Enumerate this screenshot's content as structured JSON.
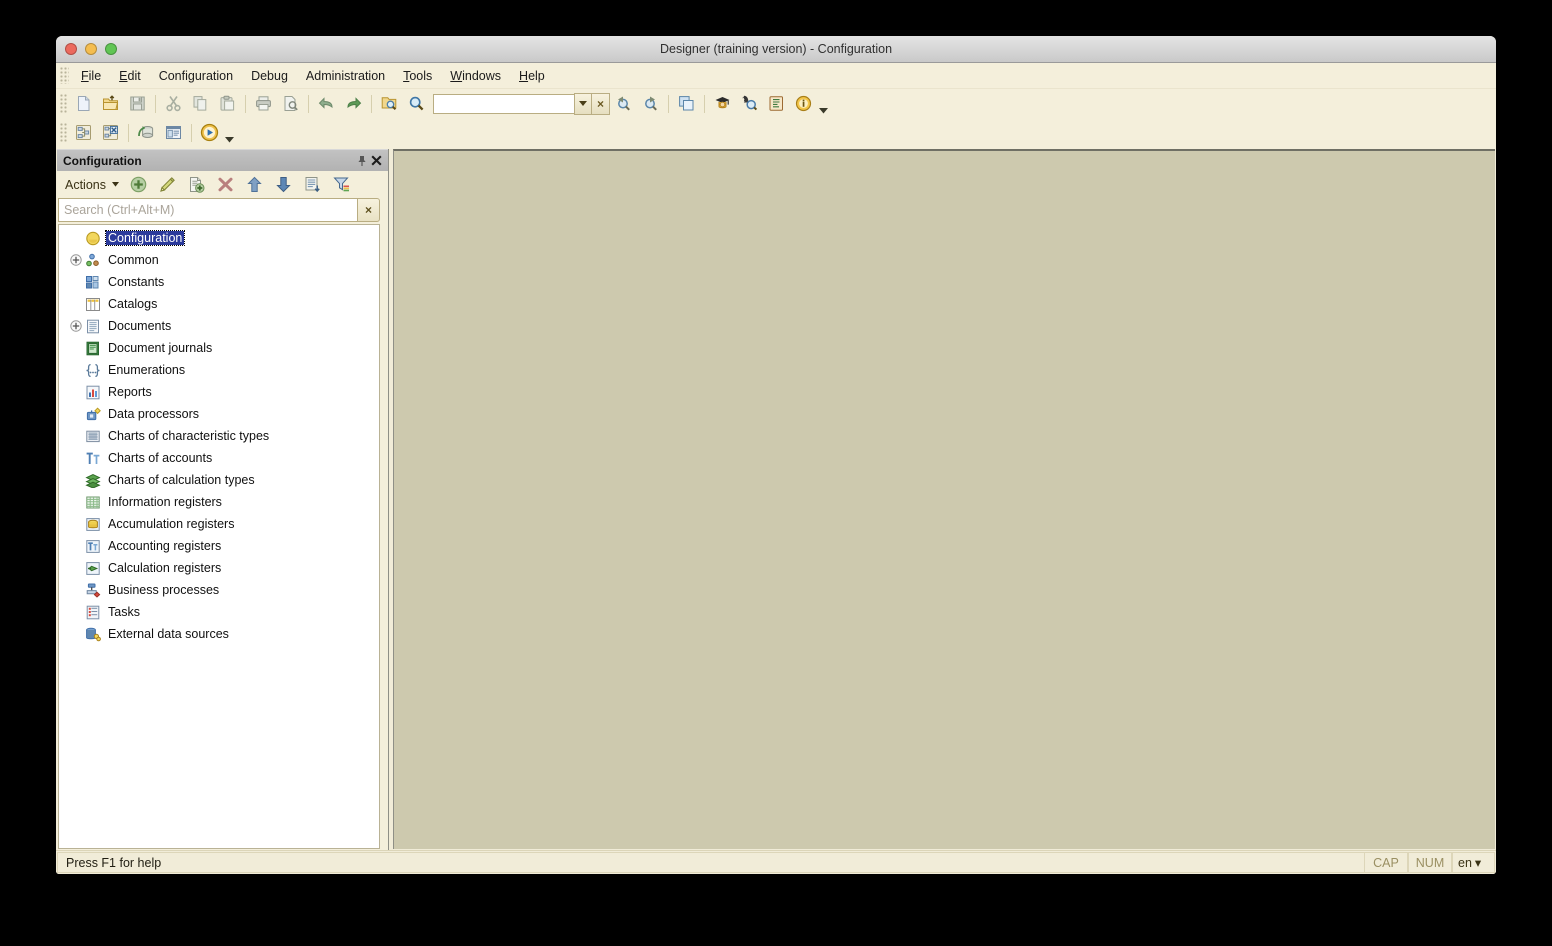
{
  "window": {
    "title": "Designer (training version) - Configuration",
    "traffic_lights": [
      "close-red",
      "minimize-yellow",
      "maximize-green"
    ]
  },
  "menubar": {
    "items": [
      {
        "label": "File",
        "accel": "F"
      },
      {
        "label": "Edit",
        "accel": "E"
      },
      {
        "label": "Configuration",
        "accel": ""
      },
      {
        "label": "Debug",
        "accel": ""
      },
      {
        "label": "Administration",
        "accel": ""
      },
      {
        "label": "Tools",
        "accel": "T"
      },
      {
        "label": "Windows",
        "accel": "W"
      },
      {
        "label": "Help",
        "accel": "H"
      }
    ]
  },
  "toolbar": {
    "row1": [
      {
        "name": "new-file-icon",
        "tip": "New"
      },
      {
        "name": "open-folder-icon",
        "tip": "Open"
      },
      {
        "name": "save-icon",
        "tip": "Save"
      },
      {
        "name": "cut-icon",
        "tip": "Cut"
      },
      {
        "name": "copy-icon",
        "tip": "Copy"
      },
      {
        "name": "paste-icon",
        "tip": "Paste"
      },
      {
        "name": "print-icon",
        "tip": "Print"
      },
      {
        "name": "print-preview-icon",
        "tip": "Print preview"
      },
      {
        "name": "undo-icon",
        "tip": "Undo"
      },
      {
        "name": "redo-icon",
        "tip": "Redo"
      },
      {
        "name": "find-in-folder-icon",
        "tip": "Search in files"
      },
      {
        "name": "search-icon",
        "tip": "Find"
      }
    ],
    "combo_value": "",
    "combo_dropdown": "chevron-down-icon",
    "combo_clear": "×",
    "row1_after_combo": [
      {
        "name": "find-previous-icon",
        "tip": "Find previous"
      },
      {
        "name": "find-next-icon",
        "tip": "Find next"
      },
      {
        "name": "windows-cascade-icon",
        "tip": "Windows"
      },
      {
        "name": "syntax-assistant-icon",
        "tip": "Syntax assistant"
      },
      {
        "name": "help-search-icon",
        "tip": "Search in help"
      },
      {
        "name": "help-contents-icon",
        "tip": "Help contents"
      },
      {
        "name": "about-info-icon",
        "tip": "About"
      }
    ],
    "row2": [
      {
        "name": "configuration-tree-icon",
        "tip": "Configuration"
      },
      {
        "name": "configuration-database-icon",
        "tip": "Database configuration"
      },
      {
        "name": "update-database-icon",
        "tip": "Update database configuration"
      },
      {
        "name": "configuration-window-icon",
        "tip": "Configuration window"
      },
      {
        "name": "start-debugging-icon",
        "tip": "Start debugging"
      }
    ]
  },
  "panel": {
    "title": "Configuration",
    "pin_icon": "pin-icon",
    "close_icon": "close-icon",
    "actions_label": "Actions",
    "actions_caret": "chevron-down-icon",
    "action_buttons": [
      {
        "name": "add-button",
        "tip": "Add"
      },
      {
        "name": "edit-button",
        "tip": "Edit"
      },
      {
        "name": "copy-button",
        "tip": "Copy"
      },
      {
        "name": "delete-button",
        "tip": "Delete"
      },
      {
        "name": "move-up-button",
        "tip": "Move up"
      },
      {
        "name": "move-down-button",
        "tip": "Move down"
      },
      {
        "name": "properties-button",
        "tip": "Properties"
      },
      {
        "name": "filter-button",
        "tip": "Filter"
      }
    ],
    "search": {
      "value": "",
      "placeholder": "Search (Ctrl+Alt+M)",
      "clear_label": "×"
    }
  },
  "tree": {
    "nodes": [
      {
        "label": "Configuration",
        "icon": "configuration-root-icon",
        "expandable": false,
        "selected": true,
        "indent": 0
      },
      {
        "label": "Common",
        "icon": "common-icon",
        "expandable": true,
        "selected": false,
        "indent": 1
      },
      {
        "label": "Constants",
        "icon": "constants-icon",
        "expandable": false,
        "selected": false,
        "indent": 1
      },
      {
        "label": "Catalogs",
        "icon": "catalogs-icon",
        "expandable": false,
        "selected": false,
        "indent": 1
      },
      {
        "label": "Documents",
        "icon": "documents-icon",
        "expandable": true,
        "selected": false,
        "indent": 1
      },
      {
        "label": "Document journals",
        "icon": "document-journals-icon",
        "expandable": false,
        "selected": false,
        "indent": 1
      },
      {
        "label": "Enumerations",
        "icon": "enumerations-icon",
        "expandable": false,
        "selected": false,
        "indent": 1
      },
      {
        "label": "Reports",
        "icon": "reports-icon",
        "expandable": false,
        "selected": false,
        "indent": 1
      },
      {
        "label": "Data processors",
        "icon": "data-processors-icon",
        "expandable": false,
        "selected": false,
        "indent": 1
      },
      {
        "label": "Charts of characteristic types",
        "icon": "charts-characteristic-icon",
        "expandable": false,
        "selected": false,
        "indent": 1
      },
      {
        "label": "Charts of accounts",
        "icon": "charts-accounts-icon",
        "expandable": false,
        "selected": false,
        "indent": 1
      },
      {
        "label": "Charts of calculation types",
        "icon": "charts-calculation-icon",
        "expandable": false,
        "selected": false,
        "indent": 1
      },
      {
        "label": "Information registers",
        "icon": "information-registers-icon",
        "expandable": false,
        "selected": false,
        "indent": 1
      },
      {
        "label": "Accumulation registers",
        "icon": "accumulation-registers-icon",
        "expandable": false,
        "selected": false,
        "indent": 1
      },
      {
        "label": "Accounting registers",
        "icon": "accounting-registers-icon",
        "expandable": false,
        "selected": false,
        "indent": 1
      },
      {
        "label": "Calculation registers",
        "icon": "calculation-registers-icon",
        "expandable": false,
        "selected": false,
        "indent": 1
      },
      {
        "label": "Business processes",
        "icon": "business-processes-icon",
        "expandable": false,
        "selected": false,
        "indent": 1
      },
      {
        "label": "Tasks",
        "icon": "tasks-icon",
        "expandable": false,
        "selected": false,
        "indent": 1
      },
      {
        "label": "External data sources",
        "icon": "external-data-sources-icon",
        "expandable": false,
        "selected": false,
        "indent": 1
      }
    ]
  },
  "statusbar": {
    "message": "Press F1 for help",
    "caps": "CAP",
    "num": "NUM",
    "language": "en",
    "language_caret": "▾"
  },
  "colors": {
    "window_bg": "#f1ecd8",
    "workspace_bg": "#cdc9ae",
    "panel_header": "#bcbcbc",
    "selection_blue": "#2b3a9b",
    "tree_bg": "#ffffff"
  }
}
